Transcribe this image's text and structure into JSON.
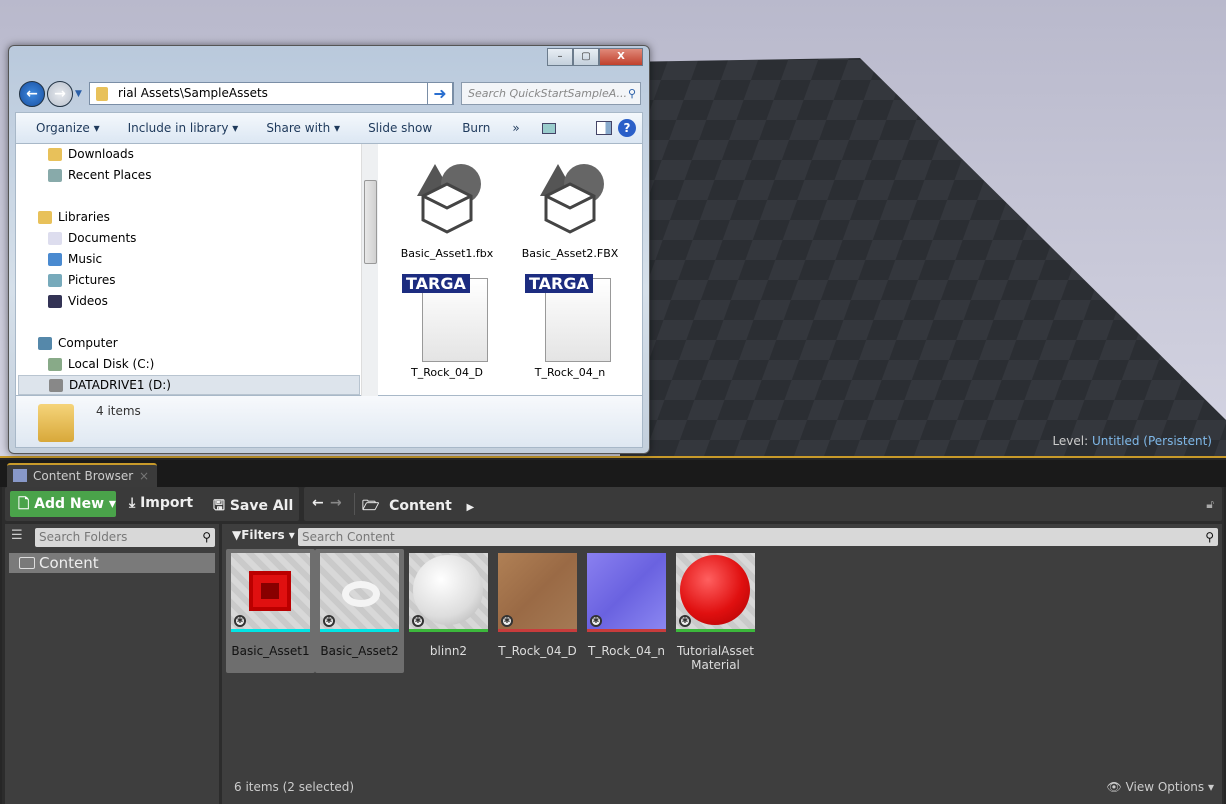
{
  "viewport": {
    "level_label": "Level:",
    "level_name": "Untitled (Persistent)"
  },
  "explorer": {
    "window_buttons": {
      "minimize": "–",
      "maximize": "▢",
      "close": "X"
    },
    "address": "rial Assets\\SampleAssets",
    "search_placeholder": "Search QuickStartSampleA...",
    "commands": [
      "Organize ▾",
      "Include in library ▾",
      "Share with ▾",
      "Slide show",
      "Burn",
      "»"
    ],
    "tree": [
      "Downloads",
      "Recent Places",
      "Libraries",
      "Documents",
      "Music",
      "Pictures",
      "Videos",
      "Computer",
      "Local Disk (C:)",
      "DATADRIVE1 (D:)"
    ],
    "files": [
      {
        "name": "Basic_Asset1.fbx",
        "type": "fbx"
      },
      {
        "name": "Basic_Asset2.FBX",
        "type": "fbx"
      },
      {
        "name": "T_Rock_04_D",
        "type": "targa"
      },
      {
        "name": "T_Rock_04_n",
        "type": "targa"
      }
    ],
    "targa_label": "TARGA",
    "item_count": "4 items"
  },
  "content_browser": {
    "tab_label": "Content Browser",
    "add_new": "Add New",
    "import": "Import",
    "save_all": "Save All",
    "path": "Content",
    "search_folders_placeholder": "Search Folders",
    "folder": "Content",
    "filters": "Filters",
    "search_content_placeholder": "Search Content",
    "assets": [
      {
        "name": "Basic_Asset1",
        "selected": true,
        "type_color": "#00e5e5"
      },
      {
        "name": "Basic_Asset2",
        "selected": true,
        "type_color": "#00e5e5"
      },
      {
        "name": "blinn2",
        "selected": false,
        "type_color": "#3cb83c"
      },
      {
        "name": "T_Rock_04_D",
        "selected": false,
        "type_color": "#c83c3c"
      },
      {
        "name": "T_Rock_04_n",
        "selected": false,
        "type_color": "#c83c3c"
      },
      {
        "name": "TutorialAsset Material",
        "selected": false,
        "type_color": "#3cb83c"
      }
    ],
    "status": "6 items (2 selected)",
    "view_options": "View Options"
  }
}
